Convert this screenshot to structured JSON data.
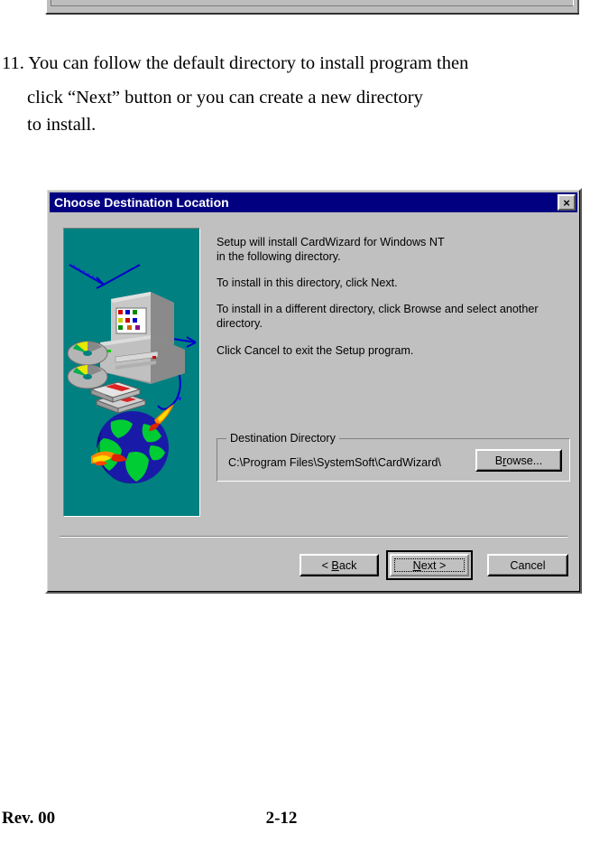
{
  "page": {
    "instruction_number": "11.",
    "instruction_line1": "You can follow the default directory to install program then",
    "instruction_body": "click  “Next”  button    or  you  can  create  a  new  directory",
    "instruction_body_last": "to install.",
    "footer_revision": "Rev. 00",
    "footer_page": "2-12"
  },
  "dialog": {
    "title": "Choose Destination Location",
    "close_label": "×",
    "close_icon": "close-icon",
    "titlebar_color": "#000080",
    "face_color": "#c0c0c0",
    "illustration_bg": "#008080",
    "body_paragraphs": [
      "Setup will install CardWizard for Windows NT in the following directory.",
      "To install in this directory, click Next.",
      "To install in a different directory, click Browse and select another directory.",
      "Click Cancel to exit the Setup program."
    ],
    "body_line_1a": "Setup will install CardWizard for Windows NT",
    "body_line_1b": "in the following directory.",
    "body_line_2": "To install in this directory, click Next.",
    "body_line_3a": "To install in a different directory, click Browse and select another",
    "body_line_3b": "directory.",
    "body_line_4": "Click Cancel to exit the Setup program.",
    "destination_group": {
      "legend": "Destination Directory",
      "path_value": "C:\\Program Files\\SystemSoft\\CardWizard\\",
      "browse_prefix": "B",
      "browse_accel": "r",
      "browse_suffix": "owse..."
    },
    "buttons": {
      "back_prefix": "< ",
      "back_accel": "B",
      "back_suffix": "ack",
      "next_prefix": "",
      "next_accel": "N",
      "next_suffix": "ext >",
      "cancel_label": "Cancel"
    }
  }
}
